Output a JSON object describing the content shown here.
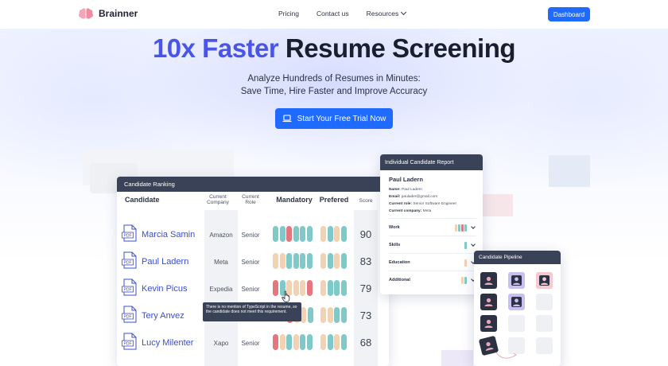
{
  "nav": {
    "logo_text": "Brainner",
    "links": [
      "Pricing",
      "Contact us",
      "Resources"
    ],
    "dashboard_label": "Dashboard"
  },
  "hero": {
    "title_accent": "10x Faster",
    "title_rest": "Resume Screening",
    "subtitle_line1": "Analyze Hundreds of Resumes in Minutes:",
    "subtitle_line2": "Save Time, Hire Faster and Improve Accuracy",
    "cta_label": "Start Your Free Trial Now"
  },
  "ranking": {
    "title": "Candidate Ranking",
    "headers": {
      "candidate": "Candidate",
      "company_l1": "Current",
      "company_l2": "Company",
      "role_l1": "Current",
      "role_l2": "Role",
      "mandatory": "Mandatory",
      "preferred": "Prefered",
      "score": "Score"
    },
    "rows": [
      {
        "name": "Marcia Samin",
        "company": "Amazon",
        "role": "Senior",
        "score": "90"
      },
      {
        "name": "Paul Ladern",
        "company": "Meta",
        "role": "Senior",
        "score": "83"
      },
      {
        "name": "Kevin Picus",
        "company": "Expedia",
        "role": "Senior",
        "score": "79"
      },
      {
        "name": "Tery Anvez",
        "company": "",
        "role": "",
        "score": "73"
      },
      {
        "name": "Lucy Milenter",
        "company": "Xapo",
        "role": "Senior",
        "score": "68"
      }
    ],
    "tooltip": "There is no mention of TypeScript in the resume, so the candidate does not meet this requirement."
  },
  "report": {
    "title": "Individual Candidate Report",
    "name": "Paul Ladern",
    "name_label": "Name:",
    "name_value": "Paul Ladern",
    "email_label": "Email:",
    "email_value": "paulader@gmail.com",
    "role_label": "Current role:",
    "role_value": "Senior Software Engineer",
    "company_label": "Current company:",
    "company_value": "Meta",
    "sections": [
      "Work",
      "Skills",
      "Education",
      "Additional"
    ]
  },
  "pipeline": {
    "title": "Candidate Pipeline"
  },
  "colors": {
    "accent": "#1f6bff",
    "title_accent": "#4a55e8",
    "card_header": "#3a4257",
    "pill_teal": "#7fc9c9",
    "pill_peach": "#f1d2b2",
    "pill_red": "#e5767d"
  }
}
